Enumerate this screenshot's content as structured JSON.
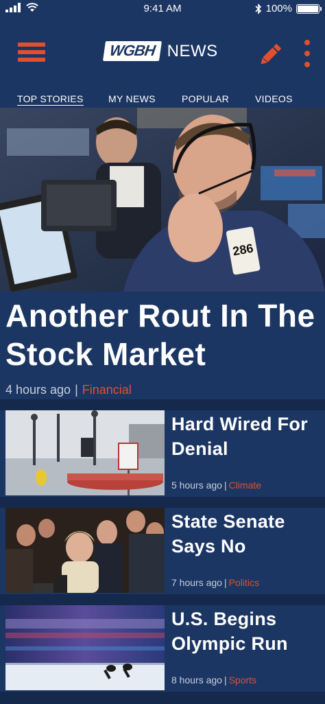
{
  "status_bar": {
    "time": "9:41 AM",
    "battery": "100%",
    "battery_level": 1.0,
    "icons": [
      "signal-icon",
      "wifi-icon",
      "bluetooth-icon",
      "battery-icon"
    ]
  },
  "header": {
    "logo_brand": "WGBH",
    "logo_suffix": "NEWS",
    "accent_color": "#e0502e",
    "background_color": "#1c3663"
  },
  "tabs": [
    {
      "label": "TOP STORIES",
      "active": true
    },
    {
      "label": "MY NEWS",
      "active": false
    },
    {
      "label": "POPULAR",
      "active": false
    },
    {
      "label": "VIDEOS",
      "active": false
    }
  ],
  "hero": {
    "title": "Another Rout In The Stock Market",
    "time": "4 hours ago",
    "separator": "|",
    "category": "Financial"
  },
  "stories": [
    {
      "title": "Hard Wired For Denial",
      "time": "5 hours ago",
      "separator": "|",
      "category": "Climate"
    },
    {
      "title": "State Senate Says No",
      "time": "7 hours ago",
      "separator": "|",
      "category": "Politics"
    },
    {
      "title": "U.S. Begins Olympic Run",
      "time": "8 hours ago",
      "separator": "|",
      "category": "Sports"
    }
  ],
  "image_text": {
    "badge_number": "286"
  }
}
